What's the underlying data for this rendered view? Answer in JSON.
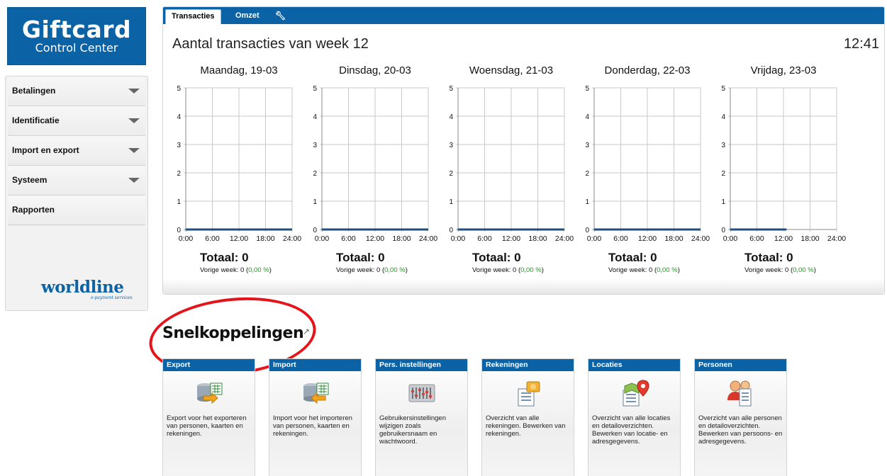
{
  "logo": {
    "line1": "Giftcard",
    "line2": "Control Center"
  },
  "sidebar": {
    "items": [
      {
        "label": "Betalingen",
        "expandable": true
      },
      {
        "label": "Identificatie",
        "expandable": true
      },
      {
        "label": "Import en export",
        "expandable": true
      },
      {
        "label": "Systeem",
        "expandable": true
      },
      {
        "label": "Rapporten",
        "expandable": false
      }
    ],
    "brand": "worldline",
    "brand_sub": "e-payment services"
  },
  "panel": {
    "tabs": [
      {
        "label": "Transacties",
        "active": true
      },
      {
        "label": "Omzet",
        "active": false
      },
      {
        "label": "",
        "icon": "wrench-icon"
      }
    ],
    "title": "Aantal transacties van week 12",
    "time": "12:41"
  },
  "days": [
    {
      "title": "Maandag, 19-03",
      "total": "Totaal: 0",
      "prev": "Vorige week: 0 (",
      "pct": "0,00 %",
      "close": ")"
    },
    {
      "title": "Dinsdag, 20-03",
      "total": "Totaal: 0",
      "prev": "Vorige week: 0 (",
      "pct": "0,00 %",
      "close": ")"
    },
    {
      "title": "Woensdag, 21-03",
      "total": "Totaal: 0",
      "prev": "Vorige week: 0 (",
      "pct": "0,00 %",
      "close": ")"
    },
    {
      "title": "Donderdag, 22-03",
      "total": "Totaal: 0",
      "prev": "Vorige week: 0 (",
      "pct": "0,00 %",
      "close": ")"
    },
    {
      "title": "Vrijdag, 23-03",
      "total": "Totaal: 0",
      "prev": "Vorige week: 0 (",
      "pct": "0,00 %",
      "close": ")"
    }
  ],
  "chart_data": [
    {
      "type": "line",
      "title": "Maandag, 19-03",
      "x": [
        "0:00",
        "6:00",
        "12:00",
        "18:00",
        "24:00"
      ],
      "ylim": [
        0,
        5
      ],
      "y_ticks": [
        0,
        1,
        2,
        3,
        4,
        5
      ],
      "series": [
        {
          "values": [
            0,
            0,
            0,
            0,
            0
          ]
        }
      ]
    },
    {
      "type": "line",
      "title": "Dinsdag, 20-03",
      "x": [
        "0:00",
        "6:00",
        "12:00",
        "18:00",
        "24:00"
      ],
      "ylim": [
        0,
        5
      ],
      "y_ticks": [
        0,
        1,
        2,
        3,
        4,
        5
      ],
      "series": [
        {
          "values": [
            0,
            0,
            0,
            0,
            0
          ]
        }
      ]
    },
    {
      "type": "line",
      "title": "Woensdag, 21-03",
      "x": [
        "0:00",
        "6:00",
        "12:00",
        "18:00",
        "24:00"
      ],
      "ylim": [
        0,
        5
      ],
      "y_ticks": [
        0,
        1,
        2,
        3,
        4,
        5
      ],
      "series": [
        {
          "values": [
            0,
            0,
            0,
            0,
            0
          ]
        }
      ]
    },
    {
      "type": "line",
      "title": "Donderdag, 22-03",
      "x": [
        "0:00",
        "6:00",
        "12:00",
        "18:00",
        "24:00"
      ],
      "ylim": [
        0,
        5
      ],
      "y_ticks": [
        0,
        1,
        2,
        3,
        4,
        5
      ],
      "series": [
        {
          "values": [
            0,
            0,
            0,
            0,
            0
          ]
        }
      ]
    },
    {
      "type": "line",
      "title": "Vrijdag, 23-03",
      "x": [
        "0:00",
        "6:00",
        "12:00",
        "18:00",
        "24:00"
      ],
      "ylim": [
        0,
        5
      ],
      "y_ticks": [
        0,
        1,
        2,
        3,
        4,
        5
      ],
      "series": [
        {
          "values": [
            0,
            0,
            0
          ],
          "x_range": [
            "0:00",
            "12:41"
          ]
        }
      ]
    }
  ],
  "shortcuts": {
    "title": "Snelkoppelingen",
    "cards": [
      {
        "title": "Export",
        "icon": "database-export-icon",
        "desc": "Export voor het exporteren van personen, kaarten en rekeningen."
      },
      {
        "title": "Import",
        "icon": "database-import-icon",
        "desc": "Import voor het importeren van personen, kaarten en rekeningen."
      },
      {
        "title": "Pers. instellingen",
        "icon": "settings-sliders-icon",
        "desc": "Gebruikersinstellingen wijzigen zoals gebruikersnaam en wachtwoord."
      },
      {
        "title": "Rekeningen",
        "icon": "accounts-list-icon",
        "desc": "Overzicht van alle rekeningen. Bewerken van rekeningen."
      },
      {
        "title": "Locaties",
        "icon": "map-pin-icon",
        "desc": "Overzicht van alle locaties en detailoverzichten. Bewerken van locatie- en adresgegevens."
      },
      {
        "title": "Personen",
        "icon": "persons-icon",
        "desc": "Overzicht van alle personen en detailoverzichten. Bewerken van persoons- en adresgegevens."
      }
    ]
  },
  "colors": {
    "brand_blue": "#0b63a6",
    "line_color": "#1f4e79",
    "positive_green": "#2e8b2e",
    "highlight_red": "#e5141a"
  }
}
